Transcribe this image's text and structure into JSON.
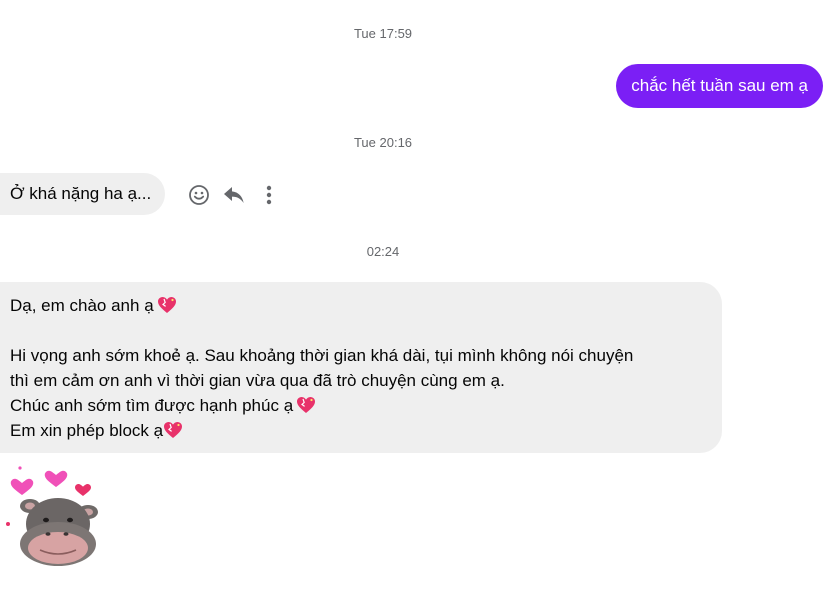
{
  "conversation": {
    "timestamp_1": "Tue 17:59",
    "outgoing_message": "chắc hết tuần sau em ạ",
    "timestamp_2": "Tue 20:16",
    "incoming_message_1": "Ở khá nặng ha ạ...",
    "timestamp_3": "02:24",
    "incoming_message_2": {
      "line_1": "Dạ, em chào anh ạ",
      "line_2": "Hi vọng anh sớm khoẻ ạ. Sau khoảng thời gian khá dài, tụi mình không nói chuyện",
      "line_3": "thì em cảm ơn anh vì thời gian vừa qua đã trò chuyện cùng em ạ.",
      "line_4": "Chúc anh sớm tìm được hạnh phúc ạ",
      "line_5": "Em xin phép block ạ"
    }
  },
  "actions": {
    "react_icon": "smiley-icon",
    "reply_icon": "reply-arrow-icon",
    "more_icon": "more-dots-icon"
  },
  "colors": {
    "outgoing_bubble": "#7b1ff5",
    "incoming_bubble": "#efefef",
    "timestamp_text": "#65676b",
    "heart": "#e8326a"
  },
  "sticker": "hippo-with-hearts-sticker"
}
